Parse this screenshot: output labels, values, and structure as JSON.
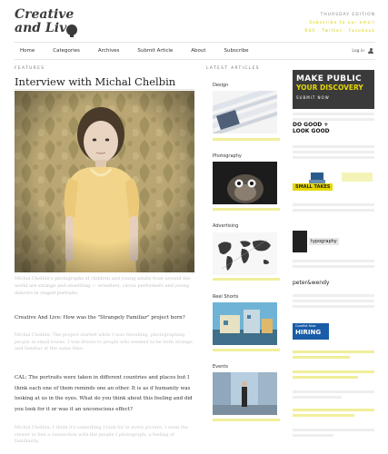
{
  "header": {
    "logo_line1": "Creative",
    "logo_line2": "and Live",
    "edition_line1": "THURSDAY EDITION",
    "edition_line2": "Subscribe to our email",
    "edition_line3": "RSS · Twitter · Facebook"
  },
  "nav": {
    "items": [
      "Home",
      "Categories",
      "Archives",
      "Submit Article",
      "About",
      "Subscribe"
    ],
    "login": "Log in"
  },
  "article": {
    "section": "FEATURES",
    "title": "Interview with Michal Chelbin",
    "caption": "Michal Chelbin's photographs of children and young adults from around the world are strange and unsettling — wrestlers, circus performers and young dancers in staged portraits.",
    "question1": "Creative And Live: How was the \"Strangely Familiar\" project born?",
    "para1": "Michal Chelbin: The project started while I was travelling, photographing people in small towns. I was drawn to people who seemed to be both strange and familiar at the same time.",
    "answer": "CAL: The portraits were taken in different countries and places but I think each one of them reminds one an other. It is as if humanity was looking at us in the eyes. What do you think about this feeling and did you look for it or was it an unconscious effect?",
    "para2": "Michal Chelbin: I think it's something I look for in every picture. I want the viewer to feel a connection with the people I photograph, a feeling of familiarity."
  },
  "latest": {
    "section": "LATEST ARTICLES",
    "categories": [
      "Design",
      "Photography",
      "Advertising",
      "Reel Shorts",
      "Events"
    ]
  },
  "sidebar": {
    "ad_line1": "MAKE PUBLIC",
    "ad_line2": "YOUR DISCOVERY",
    "ad_line3": "SUBMIT NOW",
    "dogood_line1": "DO GOOD +",
    "dogood_line2": "LOOK GOOD",
    "small_takes": "SMALL TAKES",
    "typography": "typography",
    "peter_wendy": "peter&wendy",
    "hiring_line1": "Coroflot Now",
    "hiring_line2": "HIRING"
  },
  "colors": {
    "accent_yellow": "#e6d800",
    "dark": "#3a3a3a",
    "highlight": "#f0ef9a"
  }
}
